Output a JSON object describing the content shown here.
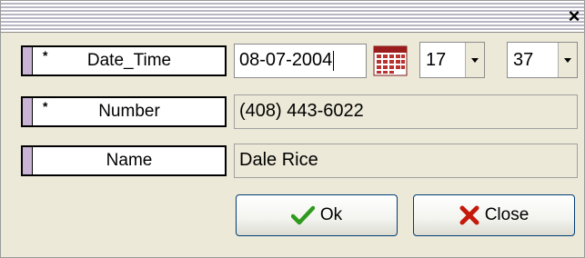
{
  "dialog": {
    "close_glyph": "×"
  },
  "rows": [
    {
      "label": "Date_Time",
      "required_mark": "*",
      "value": "08-07-2004"
    },
    {
      "label": "Number",
      "required_mark": "*",
      "value": "(408) 443-6022"
    },
    {
      "label": "Name",
      "required_mark": "",
      "value": "Dale Rice"
    }
  ],
  "time": {
    "hour": "17",
    "minute": "37"
  },
  "buttons": {
    "ok_label": "Ok",
    "close_label": "Close"
  },
  "colors": {
    "ok_check": "#2e9b1e",
    "close_x": "#c41a0c",
    "label_bar": "#c9b4d6"
  },
  "icons": {
    "calendar": "calendar-icon",
    "ok": "checkmark-icon",
    "close": "red-x-icon"
  }
}
